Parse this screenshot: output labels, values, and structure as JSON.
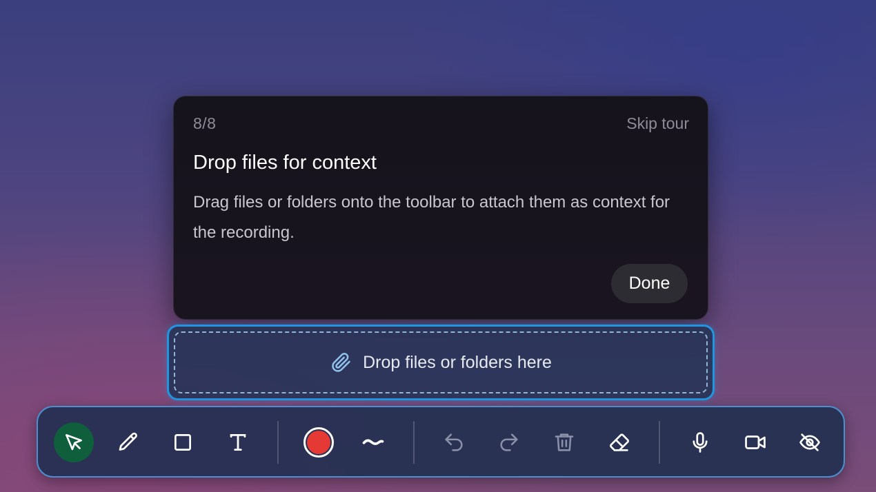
{
  "tour": {
    "step": "8/8",
    "skip_label": "Skip tour",
    "title": "Drop files for context",
    "body": "Drag files or folders onto the toolbar to attach them as context for the recording.",
    "done_label": "Done"
  },
  "dropzone": {
    "label": "Drop files or folders here",
    "icon": "paperclip-icon"
  },
  "toolbar": {
    "tools": [
      {
        "name": "select",
        "icon": "cursor-arrow-icon",
        "active": true
      },
      {
        "name": "pen",
        "icon": "pencil-icon",
        "active": false
      },
      {
        "name": "rectangle",
        "icon": "square-icon",
        "active": false
      },
      {
        "name": "text",
        "icon": "text-icon",
        "active": false
      },
      {
        "name": "color",
        "icon": "color-swatch-icon",
        "color": "#e53935"
      },
      {
        "name": "stroke",
        "icon": "stroke-wave-icon"
      },
      {
        "name": "undo",
        "icon": "undo-icon",
        "enabled": false
      },
      {
        "name": "redo",
        "icon": "redo-icon",
        "enabled": false
      },
      {
        "name": "clear",
        "icon": "trash-icon",
        "enabled": false
      },
      {
        "name": "eraser",
        "icon": "eraser-icon"
      },
      {
        "name": "microphone",
        "icon": "microphone-icon"
      },
      {
        "name": "camera",
        "icon": "video-camera-icon"
      },
      {
        "name": "hide",
        "icon": "eye-off-icon"
      }
    ]
  },
  "colors": {
    "accent_blue": "#2196e0",
    "active_tool": "#0f5e3c",
    "record_red": "#e53935"
  }
}
